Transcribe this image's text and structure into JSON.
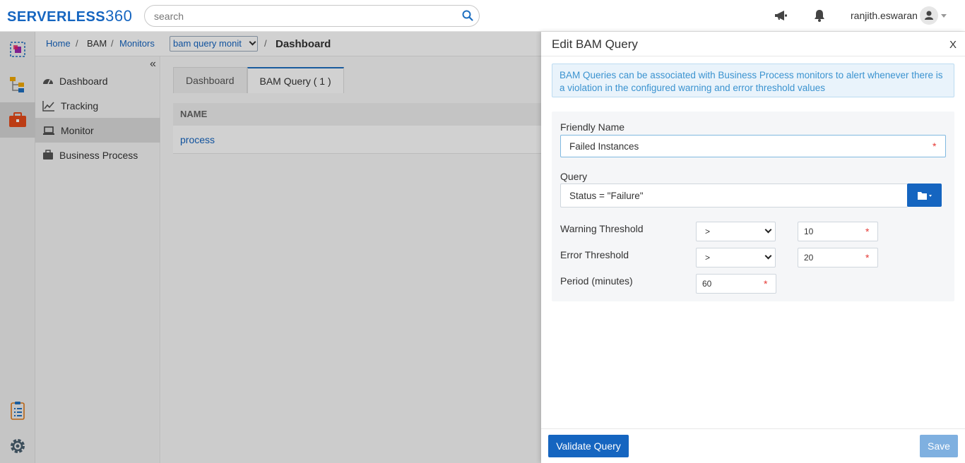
{
  "app": {
    "logo_text": "SERVERLESS",
    "logo_num": "360"
  },
  "search": {
    "placeholder": "search"
  },
  "user": {
    "name": "ranjith.eswaran"
  },
  "breadcrumb": {
    "home": "Home",
    "bam": "BAM",
    "monitors": "Monitors",
    "selected": "bam query monit",
    "current": "Dashboard",
    "sep": "/"
  },
  "sidenav": {
    "collapse": "«",
    "items": [
      {
        "label": "Dashboard"
      },
      {
        "label": "Tracking"
      },
      {
        "label": "Monitor"
      },
      {
        "label": "Business Process"
      }
    ]
  },
  "tabs": [
    {
      "label": "Dashboard"
    },
    {
      "label": "BAM Query ( 1 )"
    }
  ],
  "table": {
    "header": "NAME",
    "rows": [
      {
        "name": "process"
      }
    ]
  },
  "drawer": {
    "title": "Edit BAM Query",
    "close": "X",
    "info": "BAM Queries can be associated with Business Process monitors to alert whenever there is a violation in the configured warning and error threshold values",
    "friendly_name_label": "Friendly Name",
    "friendly_name_value": "Failed Instances",
    "query_label": "Query",
    "query_value": "Status = \"Failure\"",
    "warning_label": "Warning Threshold",
    "warning_operator": ">",
    "warning_value": "10",
    "error_label": "Error Threshold",
    "error_operator": ">",
    "error_value": "20",
    "period_label": "Period (minutes)",
    "period_value": "60",
    "required_mark": "*",
    "validate_button": "Validate Query",
    "save_button": "Save"
  },
  "colors": {
    "primary": "#1565c0",
    "info_bg": "#e9f3fb",
    "info_text": "#3b93d0",
    "required": "#e53935",
    "save_disabled": "#7fb0e0"
  }
}
